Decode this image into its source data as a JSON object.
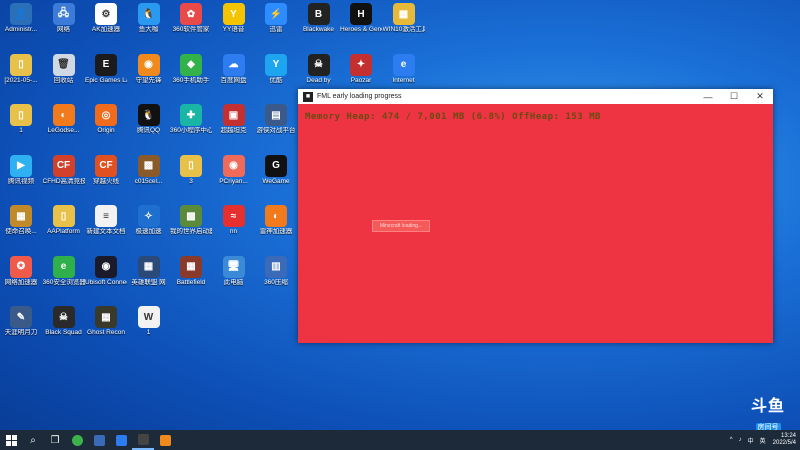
{
  "desktop_icons": [
    {
      "label": "Administr...",
      "color": "#2b6fb8",
      "glyph": "👤"
    },
    {
      "label": "网络",
      "color": "#3c7bd8",
      "glyph": "🖧"
    },
    {
      "label": "AK加速器",
      "color": "#ffffff",
      "glyph": "⚙"
    },
    {
      "label": "鱼大咖",
      "color": "#2a9af0",
      "glyph": "🐧"
    },
    {
      "label": "360软件管家",
      "color": "#e84a4a",
      "glyph": "✿"
    },
    {
      "label": "YY语音",
      "color": "#f5c400",
      "glyph": "Y"
    },
    {
      "label": "迅雷",
      "color": "#2d8cff",
      "glyph": "⚡"
    },
    {
      "label": "Blackwake",
      "color": "#222222",
      "glyph": "B"
    },
    {
      "label": "Heroes & Generals",
      "color": "#111111",
      "glyph": "H"
    },
    {
      "label": "WIN10激活工具",
      "color": "#e6b93a",
      "glyph": "▦"
    },
    {
      "label": "[2021-05-...",
      "color": "#e8c14a",
      "glyph": "▯"
    },
    {
      "label": "回收站",
      "color": "#cfd8e3",
      "glyph": "🗑"
    },
    {
      "label": "Epic Games Launcher",
      "color": "#1b1b1b",
      "glyph": "E"
    },
    {
      "label": "守望先锋",
      "color": "#f08a1c",
      "glyph": "◉"
    },
    {
      "label": "360手机助手",
      "color": "#33b24a",
      "glyph": "◆"
    },
    {
      "label": "百度网盘",
      "color": "#2d7cf0",
      "glyph": "☁"
    },
    {
      "label": "优酷",
      "color": "#1ea5f0",
      "glyph": "Y"
    },
    {
      "label": "Dead by",
      "color": "#222222",
      "glyph": "☠"
    },
    {
      "label": "Paozar",
      "color": "#c42f2f",
      "glyph": "✦"
    },
    {
      "label": "Internet",
      "color": "#2d7cf0",
      "glyph": "e"
    },
    {
      "label": "1",
      "color": "#e8c14a",
      "glyph": "▯"
    },
    {
      "label": "LeGodse...",
      "color": "#f07a1c",
      "glyph": "◐"
    },
    {
      "label": "Origin",
      "color": "#f06b1c",
      "glyph": "◎"
    },
    {
      "label": "腾讯QQ",
      "color": "#111111",
      "glyph": "🐧"
    },
    {
      "label": "360小程序中心",
      "color": "#19b5a5",
      "glyph": "✚"
    },
    {
      "label": "超越坦克",
      "color": "#c43030",
      "glyph": "▣"
    },
    {
      "label": "游侠对战平台",
      "color": "#3b5a8a",
      "glyph": "▤"
    },
    {
      "label": "2",
      "color": "#e8c14a",
      "glyph": "▯"
    },
    {
      "label": "MCLaunc...",
      "color": "#6b9a3a",
      "glyph": "▩"
    },
    {
      "label": "Steam",
      "color": "#1b2838",
      "glyph": "◍"
    },
    {
      "label": "腾讯视频",
      "color": "#2fb0f0",
      "glyph": "▶"
    },
    {
      "label": "CFHD高清竞技大区",
      "color": "#d0402a",
      "glyph": "CF"
    },
    {
      "label": "穿越火线",
      "color": "#e05020",
      "glyph": "CF"
    },
    {
      "label": "c015cel...",
      "color": "#8a5a2a",
      "glyph": "▩"
    },
    {
      "label": "3",
      "color": "#e8c14a",
      "glyph": "▯"
    },
    {
      "label": "PCriyan...",
      "color": "#f06a5a",
      "glyph": "◉"
    },
    {
      "label": "WeGame",
      "color": "#111111",
      "glyph": "G"
    },
    {
      "label": "微信",
      "color": "#2ec24a",
      "glyph": "✉"
    },
    {
      "label": "Flash中心",
      "color": "#2d7cf0",
      "glyph": "ƒ"
    },
    {
      "label": "酷狗音乐",
      "color": "#1e78e6",
      "glyph": "K"
    },
    {
      "label": "使命召唤...",
      "color": "#c08a2a",
      "glyph": "▦"
    },
    {
      "label": "AAPlatform",
      "color": "#e8c14a",
      "glyph": "▯"
    },
    {
      "label": "新建文本文档",
      "color": "#f2f2f2",
      "glyph": "≡"
    },
    {
      "label": "极速加速",
      "color": "#1e6fd0",
      "glyph": "✧"
    },
    {
      "label": "我的世界启动器",
      "color": "#5a8a3a",
      "glyph": "▩"
    },
    {
      "label": "nn",
      "color": "#e63030",
      "glyph": "≈"
    },
    {
      "label": "雷神加速器",
      "color": "#f07a1c",
      "glyph": "◐"
    },
    {
      "label": "ARK Surviv...",
      "color": "#2a2a2a",
      "glyph": "A"
    },
    {
      "label": "视频",
      "color": "#e8c14a",
      "glyph": "▯"
    },
    {
      "label": "360驱动大师",
      "color": "#3a8ad8",
      "glyph": "◎"
    },
    {
      "label": "网络加速器",
      "color": "#f05a4a",
      "glyph": "✪"
    },
    {
      "label": "360安全浏览器",
      "color": "#2fb04a",
      "glyph": "e"
    },
    {
      "label": "Ubisoft Connect",
      "color": "#1a1a2a",
      "glyph": "◉"
    },
    {
      "label": "英雄联盟 网",
      "color": "#2a4a7a",
      "glyph": "▦"
    },
    {
      "label": "Battlefield",
      "color": "#8a3a2a",
      "glyph": "▦"
    },
    {
      "label": "此电脑",
      "color": "#3a8ad8",
      "glyph": "🖥"
    },
    {
      "label": "360压缩",
      "color": "#3a6ab8",
      "glyph": "▥"
    },
    {
      "label": "斗鱼直播伴侣",
      "color": "#f07a1c",
      "glyph": "◉"
    },
    {
      "label": "360安全卫士",
      "color": "#2fb04a",
      "glyph": "+"
    },
    {
      "label": "WPS Office",
      "color": "#e03030",
      "glyph": "W"
    },
    {
      "label": "天涯明月刀",
      "color": "#3a5a8a",
      "glyph": "✎"
    },
    {
      "label": "Black Squad",
      "color": "#2a2a2a",
      "glyph": "☠"
    },
    {
      "label": "Ghost Recon",
      "color": "#3a3a2a",
      "glyph": "▦"
    },
    {
      "label": "1",
      "color": "#f2f2f2",
      "glyph": "W"
    }
  ],
  "window": {
    "title": "FML early loading progress",
    "memory_line": "Memory Heap: 474 / 7,001 MB (6.8%)  OffHeap: 153 MB",
    "progress_text": "Minecraft loading...",
    "bg_color": "#ee3342"
  },
  "watermark": {
    "logo": "斗鱼",
    "badge": "房间号",
    "room": "501305"
  },
  "taskbar": {
    "clock_time": "13:24",
    "clock_date": "2022/5/4",
    "tray_lang": "中",
    "tray_ime": "英"
  }
}
